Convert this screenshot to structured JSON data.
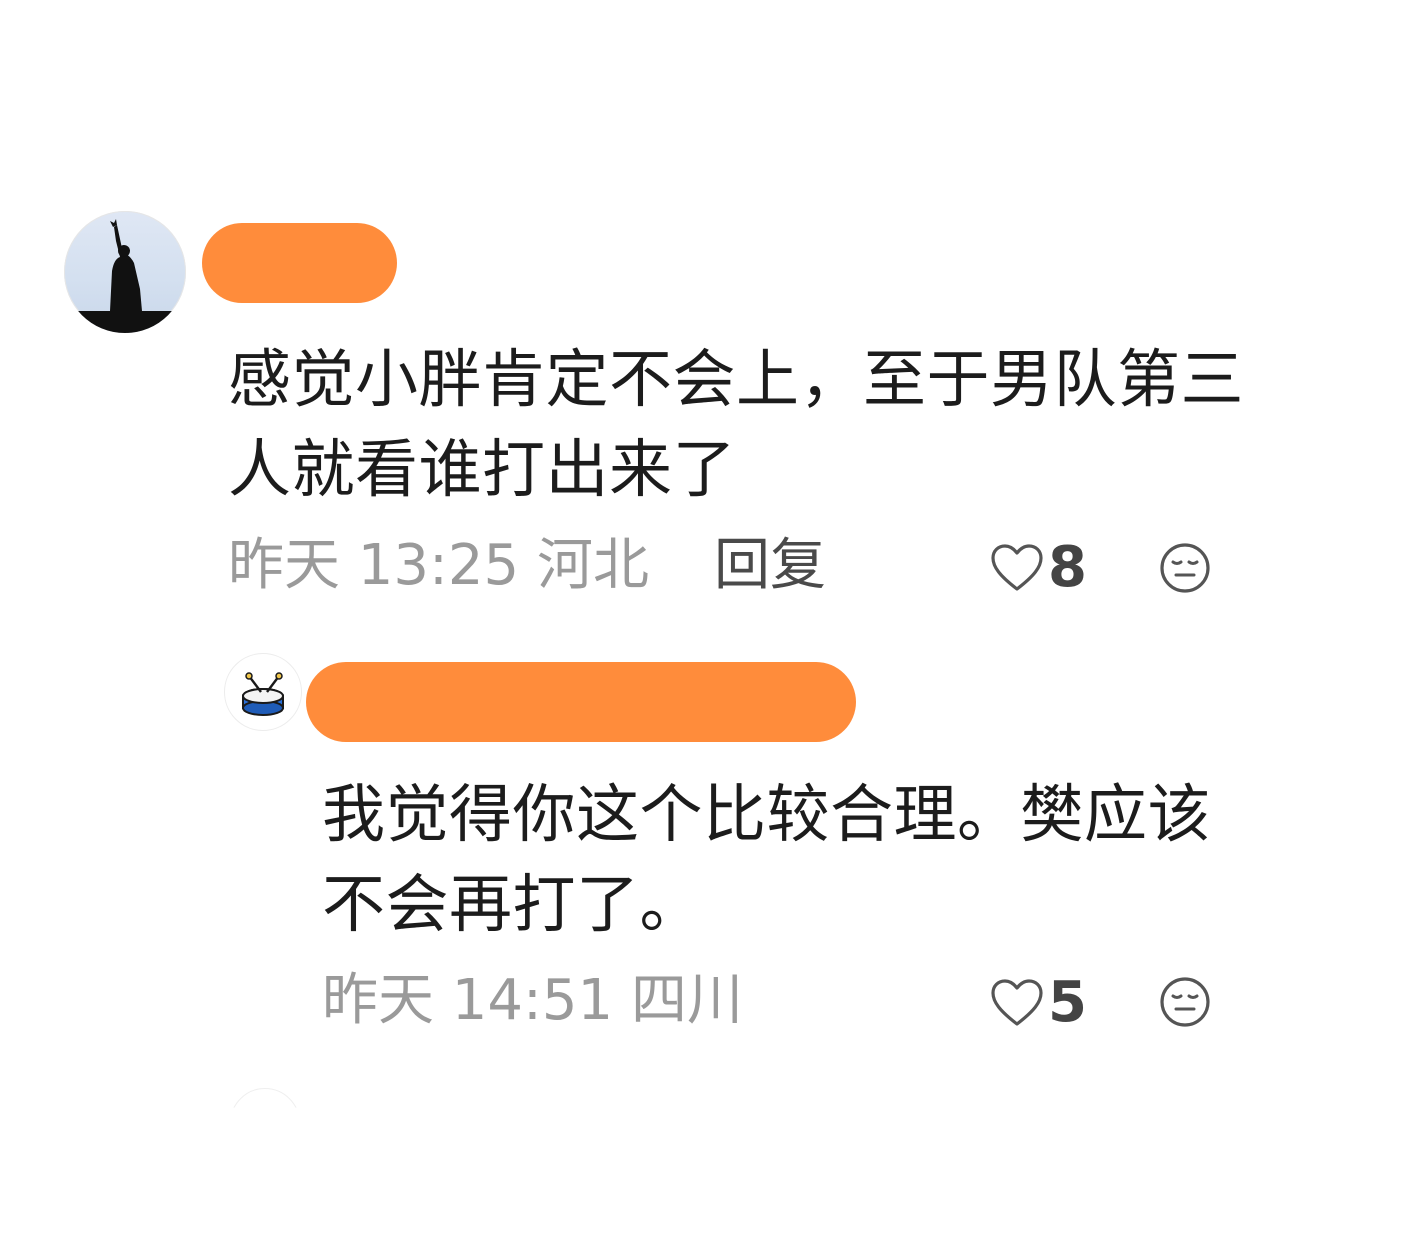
{
  "comment": {
    "username": "",
    "text": "感觉小胖肯定不会上，至于男队第三人就看谁打出来了",
    "time": "昨天 13:25",
    "location": "河北",
    "reply_label": "回复",
    "likes": "8",
    "like_icon": "heart-outline-icon",
    "reaction_icon": "neutral-face-icon"
  },
  "reply": {
    "username": "",
    "text": "我觉得你这个比较合理。樊应该不会再打了。",
    "time": "昨天 14:51",
    "location": "四川",
    "likes": "5",
    "like_icon": "heart-outline-icon",
    "reaction_icon": "neutral-face-icon"
  },
  "colors": {
    "redaction": "#ff8c3b",
    "meta_text": "#9a9a9a",
    "body_text": "#1c1c1c"
  }
}
